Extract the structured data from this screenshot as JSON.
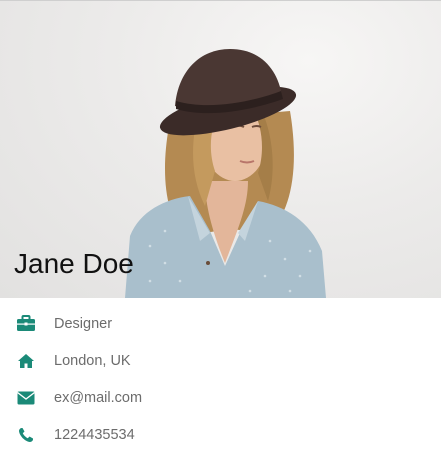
{
  "profile": {
    "name": "Jane Doe",
    "accent_color": "#1b8a78",
    "details": [
      {
        "icon": "briefcase-icon",
        "text": "Designer"
      },
      {
        "icon": "home-icon",
        "text": "London, UK"
      },
      {
        "icon": "envelope-icon",
        "text": "ex@mail.com"
      },
      {
        "icon": "phone-icon",
        "text": "1224435534"
      }
    ]
  }
}
